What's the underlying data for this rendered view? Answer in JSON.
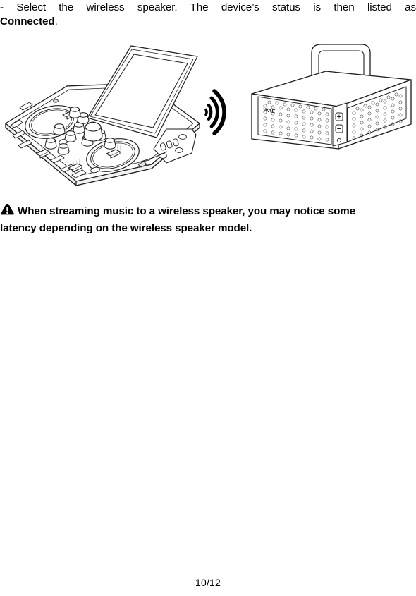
{
  "document": {
    "step": {
      "line1": "- Select the wireless speaker. The device’s status is then listed as",
      "line2_bold": "Connected",
      "line2_tail": "."
    },
    "note": {
      "icon": "warning-triangle-icon",
      "line1": "When streaming music to a wireless speaker, you may notice some",
      "line2": "latency depending on the wireless speaker model."
    },
    "footer": {
      "page_number": "10/12"
    }
  },
  "illustration": {
    "caption": "DJ controller with tablet streaming wirelessly to a portable speaker",
    "devices": {
      "controller": {
        "name": "dj-controller",
        "label": "DJ controller with two jog wheels, knobs and faders"
      },
      "tablet": {
        "name": "tablet-screen",
        "label": "Tablet docked on the controller"
      },
      "wireless_signal": {
        "name": "wireless-signal-icon",
        "arcs": 3
      },
      "speaker": {
        "name": "wireless-speaker",
        "brand": "WAE",
        "buttons": [
          "+",
          "−"
        ]
      }
    }
  },
  "colors": {
    "ink": "#000000",
    "line": "#231f20",
    "paper": "#ffffff"
  }
}
